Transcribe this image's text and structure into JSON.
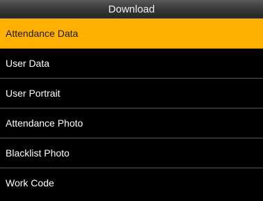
{
  "header": {
    "title": "Download"
  },
  "menu": {
    "selected_index": 0,
    "items": [
      {
        "label": "Attendance Data"
      },
      {
        "label": "User Data"
      },
      {
        "label": "User Portrait"
      },
      {
        "label": "Attendance Photo"
      },
      {
        "label": "Blacklist Photo"
      },
      {
        "label": "Work Code"
      }
    ]
  },
  "colors": {
    "selection_highlight": "#ffb000",
    "background": "#000000",
    "text": "#ffffff"
  }
}
